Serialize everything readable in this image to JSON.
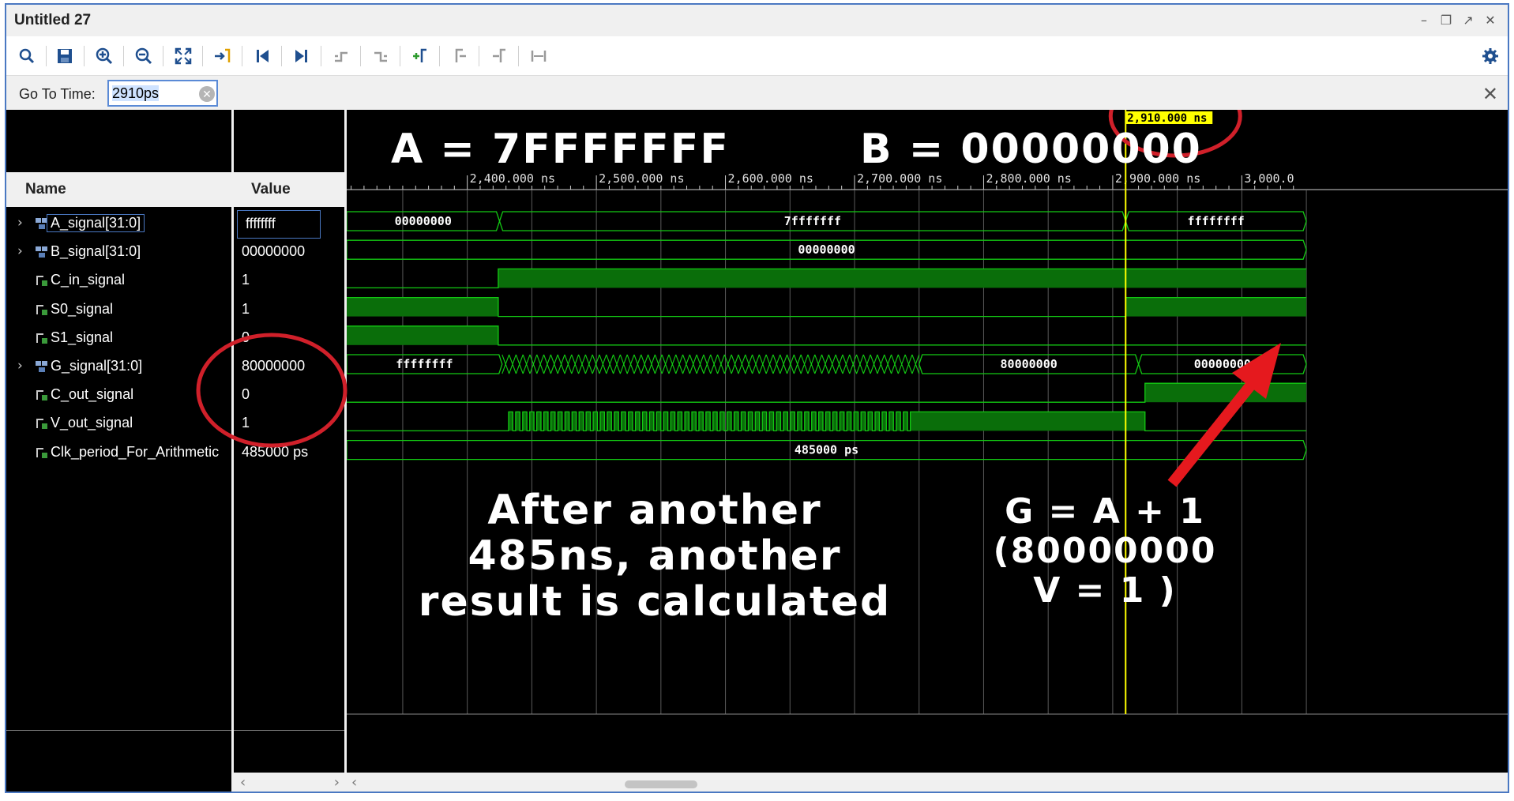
{
  "window": {
    "title": "Untitled 27"
  },
  "toolbar": {
    "icons": [
      "search-icon",
      "save-icon",
      "zoom-in-icon",
      "zoom-out-icon",
      "zoom-fit-icon",
      "go-to-cursor-icon",
      "go-to-start-icon",
      "go-to-end-icon",
      "previous-transition-icon",
      "next-transition-icon",
      "add-marker-icon",
      "previous-marker-icon",
      "next-marker-icon",
      "swap-cursors-icon",
      "settings-icon"
    ]
  },
  "goto": {
    "label": "Go To Time:",
    "value": "2910ps"
  },
  "columns": {
    "name": "Name",
    "value": "Value"
  },
  "signals": [
    {
      "name": "A_signal[31:0]",
      "value": "ffffffff",
      "type": "bus"
    },
    {
      "name": "B_signal[31:0]",
      "value": "00000000",
      "type": "bus"
    },
    {
      "name": "C_in_signal",
      "value": "1",
      "type": "bit"
    },
    {
      "name": "S0_signal",
      "value": "1",
      "type": "bit"
    },
    {
      "name": "S1_signal",
      "value": "0",
      "type": "bit"
    },
    {
      "name": "G_signal[31:0]",
      "value": "80000000",
      "type": "bus"
    },
    {
      "name": "C_out_signal",
      "value": "0",
      "type": "bit"
    },
    {
      "name": "V_out_signal",
      "value": "1",
      "type": "bit"
    },
    {
      "name": "Clk_period_For_Arithmetic",
      "value": "485000 ps",
      "type": "bit"
    }
  ],
  "timeline": {
    "cursor_label": "2,910.000 ns",
    "cursor_time_ns": 2910,
    "ticks": [
      {
        "t": 2400,
        "label": "2,400.000 ns"
      },
      {
        "t": 2500,
        "label": "2,500.000 ns"
      },
      {
        "t": 2600,
        "label": "2,600.000 ns"
      },
      {
        "t": 2700,
        "label": "2,700.000 ns"
      },
      {
        "t": 2800,
        "label": "2,800.000 ns"
      },
      {
        "t": 2900,
        "label": "2,900.000 ns"
      },
      {
        "t": 3000,
        "label": "3,000.0"
      }
    ]
  },
  "waves": {
    "a_bus": [
      "00000000",
      "7fffffff",
      "ffffffff"
    ],
    "b_bus": [
      "00000000"
    ],
    "g_bus": [
      "ffffffff",
      "80000000",
      "00000000"
    ],
    "clk_bus": [
      "485000 ps"
    ]
  },
  "annotations": {
    "top_a": "A = 7FFFFFFF",
    "top_b": "B = 00000000",
    "middle": [
      "After another",
      "485ns, another",
      "result is calculated"
    ],
    "right": [
      "G = A + 1",
      "(80000000",
      "V = 1 )"
    ]
  },
  "colors": {
    "wave_green": "#13c913",
    "wave_fill": "#0a6e0a",
    "cursor": "#ffff00",
    "highlight_circle": "#d0202a",
    "arrow": "#e5191e",
    "frame_border": "#4a78c2"
  }
}
